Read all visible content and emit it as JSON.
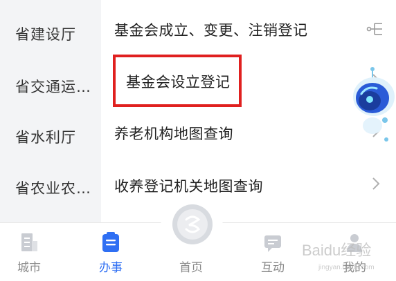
{
  "departments": [
    {
      "label": "省建设厅"
    },
    {
      "label": "省交通运…"
    },
    {
      "label": "省水利厅"
    },
    {
      "label": "省农业农…"
    }
  ],
  "services": [
    {
      "label": "基金会成立、变更、注销登记"
    },
    {
      "label": "基金会设立登记"
    },
    {
      "label": "养老机构地图查询"
    },
    {
      "label": "收养登记机关地图查询"
    }
  ],
  "tabs": [
    {
      "label": "城市",
      "active": false
    },
    {
      "label": "办事",
      "active": true
    },
    {
      "label": "首页",
      "active": false
    },
    {
      "label": "互动",
      "active": false
    },
    {
      "label": "我的",
      "active": false
    }
  ],
  "watermark": {
    "text": "Baidu经验",
    "sub": "jingyan.baidu.com"
  },
  "colors": {
    "accent": "#2f6ff3",
    "highlight": "#e0201f",
    "inactive": "#8a8a8a"
  },
  "icons": [
    "tree-icon",
    "chevron-right-icon",
    "robot-assistant-icon",
    "city-icon",
    "office-icon",
    "home-icon",
    "interact-icon",
    "profile-icon"
  ]
}
